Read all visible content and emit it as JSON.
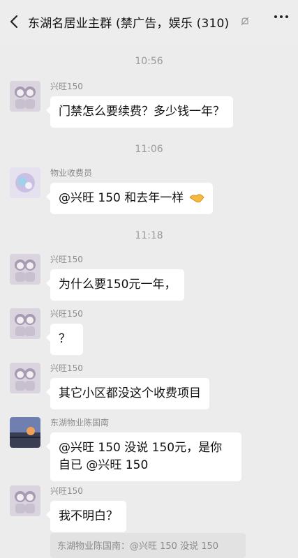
{
  "header": {
    "title": "东湖名居业主群 (禁广告，娱乐 (310)",
    "back_icon": "chevron-left-icon",
    "mute_icon": "bell-off-icon",
    "more_icon": "more-dots-icon"
  },
  "timestamps": [
    "10:56",
    "11:06",
    "11:18"
  ],
  "messages": [
    {
      "sender": "兴旺150",
      "text": "门禁怎么要续费？多少钱一年？",
      "avatar": "avatar-xingwang"
    },
    {
      "sender": "物业收费员",
      "text": "@兴旺 150 和去年一样",
      "emoji": "handshake-emoji",
      "avatar": "avatar-fee-collector"
    },
    {
      "sender": "兴旺150",
      "text": "为什么要150元一年，",
      "avatar": "avatar-xingwang"
    },
    {
      "sender": "兴旺150",
      "text": "？",
      "avatar": "avatar-xingwang"
    },
    {
      "sender": "兴旺150",
      "text": "其它小区都没这个收费项目",
      "avatar": "avatar-xingwang"
    },
    {
      "sender": "东湖物业陈国南",
      "text": "@兴旺 150 没说 150元，是你自已 @兴旺 150",
      "avatar": "avatar-chen"
    },
    {
      "sender": "兴旺150",
      "text": "我不明白？",
      "avatar": "avatar-xingwang"
    }
  ],
  "quote": {
    "text": "东湖物业陈国南：@兴旺 150 没说 150"
  }
}
